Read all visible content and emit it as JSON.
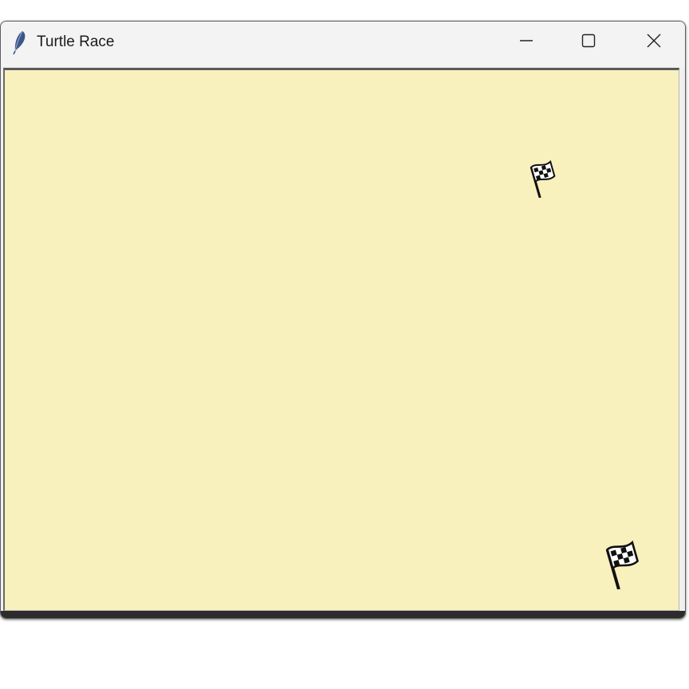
{
  "window": {
    "title": "Turtle Race",
    "app_icon": "feather-icon",
    "controls": [
      "minimize-icon",
      "maximize-icon",
      "close-icon"
    ]
  },
  "canvas": {
    "background_color": "#f8f0bd",
    "markers": [
      {
        "icon": "checkered-flag-icon"
      },
      {
        "icon": "checkered-flag-icon"
      }
    ]
  }
}
